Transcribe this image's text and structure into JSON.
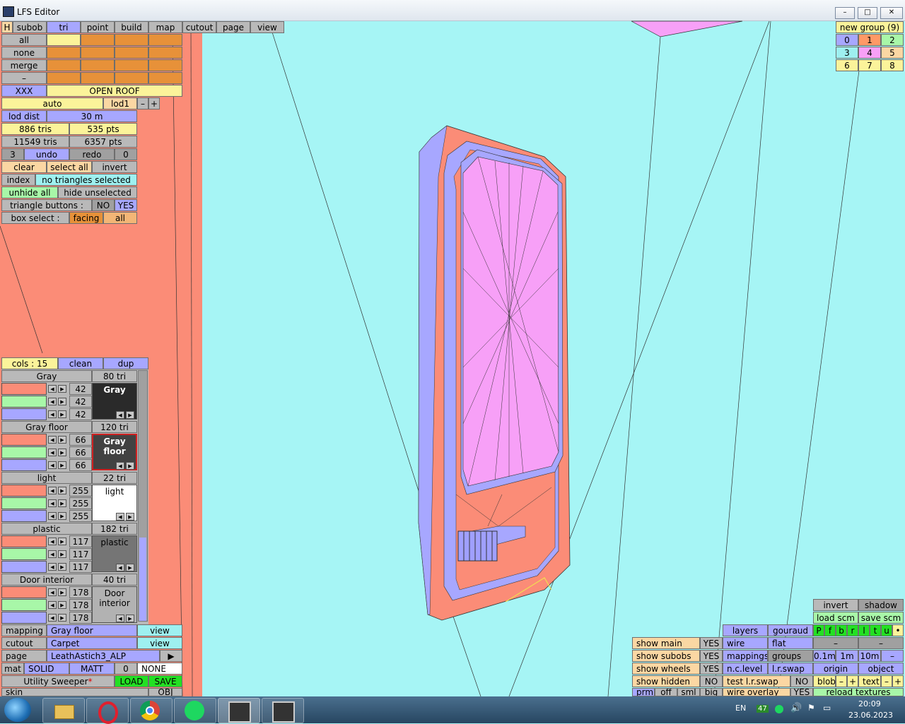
{
  "window": {
    "title": "LFS Editor",
    "buttons": [
      "–",
      "□",
      "✕"
    ]
  },
  "menu": {
    "h": "H",
    "tabs": [
      "subob",
      "tri",
      "point",
      "build",
      "map",
      "cutout",
      "page",
      "view"
    ]
  },
  "subobs": {
    "rows": [
      "all",
      "none",
      "merge",
      "–"
    ],
    "xxx": "XXX",
    "name": "OPEN ROOF"
  },
  "lod": {
    "auto": "auto",
    "lod": "lod1",
    "minus": "–",
    "plus": "+",
    "dist_label": "lod dist",
    "dist_value": "30 m"
  },
  "stats": {
    "tris1": "886 tris",
    "pts1": "535 pts",
    "tris2": "11549 tris",
    "pts2": "6357 pts"
  },
  "undo": {
    "count": "3",
    "undo": "undo",
    "redo": "redo",
    "redo_count": "0"
  },
  "select": {
    "clear": "clear",
    "select_all": "select all",
    "invert": "invert",
    "index": "index",
    "status": "no triangles selected",
    "unhide_all": "unhide all",
    "hide_unselected": "hide unselected",
    "tri_buttons": "triangle buttons :",
    "no": "NO",
    "yes": "YES",
    "box_select": "box select :",
    "facing": "facing",
    "all": "all"
  },
  "colours": {
    "header": {
      "cols": "cols : 15",
      "clean": "clean",
      "dup": "dup"
    },
    "items": [
      {
        "name": "Gray",
        "tri": "80 tri",
        "r": "42",
        "g": "42",
        "b": "42",
        "preview": "Gray",
        "swatch": "#2a2a2a",
        "text": "#ffffff"
      },
      {
        "name": "Gray floor",
        "tri": "120 tri",
        "r": "66",
        "g": "66",
        "b": "66",
        "preview": "Gray floor",
        "swatch": "#424242",
        "text": "#ffffff"
      },
      {
        "name": "light",
        "tri": "22 tri",
        "r": "255",
        "g": "255",
        "b": "255",
        "preview": "light",
        "swatch": "#ffffff",
        "text": "#000000"
      },
      {
        "name": "plastic",
        "tri": "182 tri",
        "r": "117",
        "g": "117",
        "b": "117",
        "preview": "plastic",
        "swatch": "#757575",
        "text": "#000000"
      },
      {
        "name": "Door interior",
        "tri": "40 tri",
        "r": "178",
        "g": "178",
        "b": "178",
        "preview": "Door interior",
        "swatch": "#b2b2b2",
        "text": "#000000"
      }
    ]
  },
  "mapping": {
    "mapping": "mapping",
    "mapping_val": "Gray floor",
    "view": "view",
    "cutout": "cutout",
    "cutout_val": "Carpet",
    "view2": "view",
    "page": "page",
    "page_val": "LeathAstich3_ALP",
    "arrow": "▶",
    "mat": "mat",
    "solid": "SOLID",
    "matt": "MATT",
    "zero": "0",
    "none": "NONE",
    "utility": "Utility Sweeper",
    "star": "*",
    "load": "LOAD",
    "save": "SAVE",
    "skin": "skin",
    "obj": "OBJ"
  },
  "groups": {
    "title": "new group (9)",
    "nums": [
      "0",
      "1",
      "2",
      "3",
      "4",
      "5",
      "6",
      "7",
      "8"
    ]
  },
  "right": {
    "invert": "invert",
    "shadow": "shadow",
    "load_scm": "load scm",
    "save_scm": "save scm",
    "layers": "layers",
    "gouraud": "gouraud",
    "letters": [
      "P",
      "f",
      "b",
      "r",
      "l",
      "t",
      "u",
      "•"
    ],
    "wire": "wire",
    "flat": "flat",
    "mappings": "mappings",
    "groups": "groups",
    "d1": "0.1m",
    "d2": "1m",
    "d3": "10m",
    "dminus": "–",
    "ncl": "n.c.level",
    "lrs": "l.r.swap",
    "origin": "origin",
    "object": "object",
    "test": "test l.r.swap",
    "test_no": "NO",
    "blob": "blob",
    "text": "text",
    "minus": "–",
    "plus": "+",
    "wire_overlay": "wire overlay",
    "wo_yes": "YES",
    "reload": "reload textures",
    "show_main": "show main",
    "show_subobs": "show subobs",
    "show_wheels": "show wheels",
    "show_hidden": "show hidden",
    "yes": "YES",
    "no": "NO",
    "prm": "prm",
    "off": "off",
    "sml": "sml",
    "big": "big"
  },
  "taskbar": {
    "lang": "EN",
    "badge": "47",
    "time": "20:09",
    "date": "23.06.2023"
  },
  "colors": {
    "salmon": "#fb8c77",
    "viewport": "#a6f5f5",
    "pink": "#f7a0f7",
    "lavender": "#a7a7ff"
  }
}
